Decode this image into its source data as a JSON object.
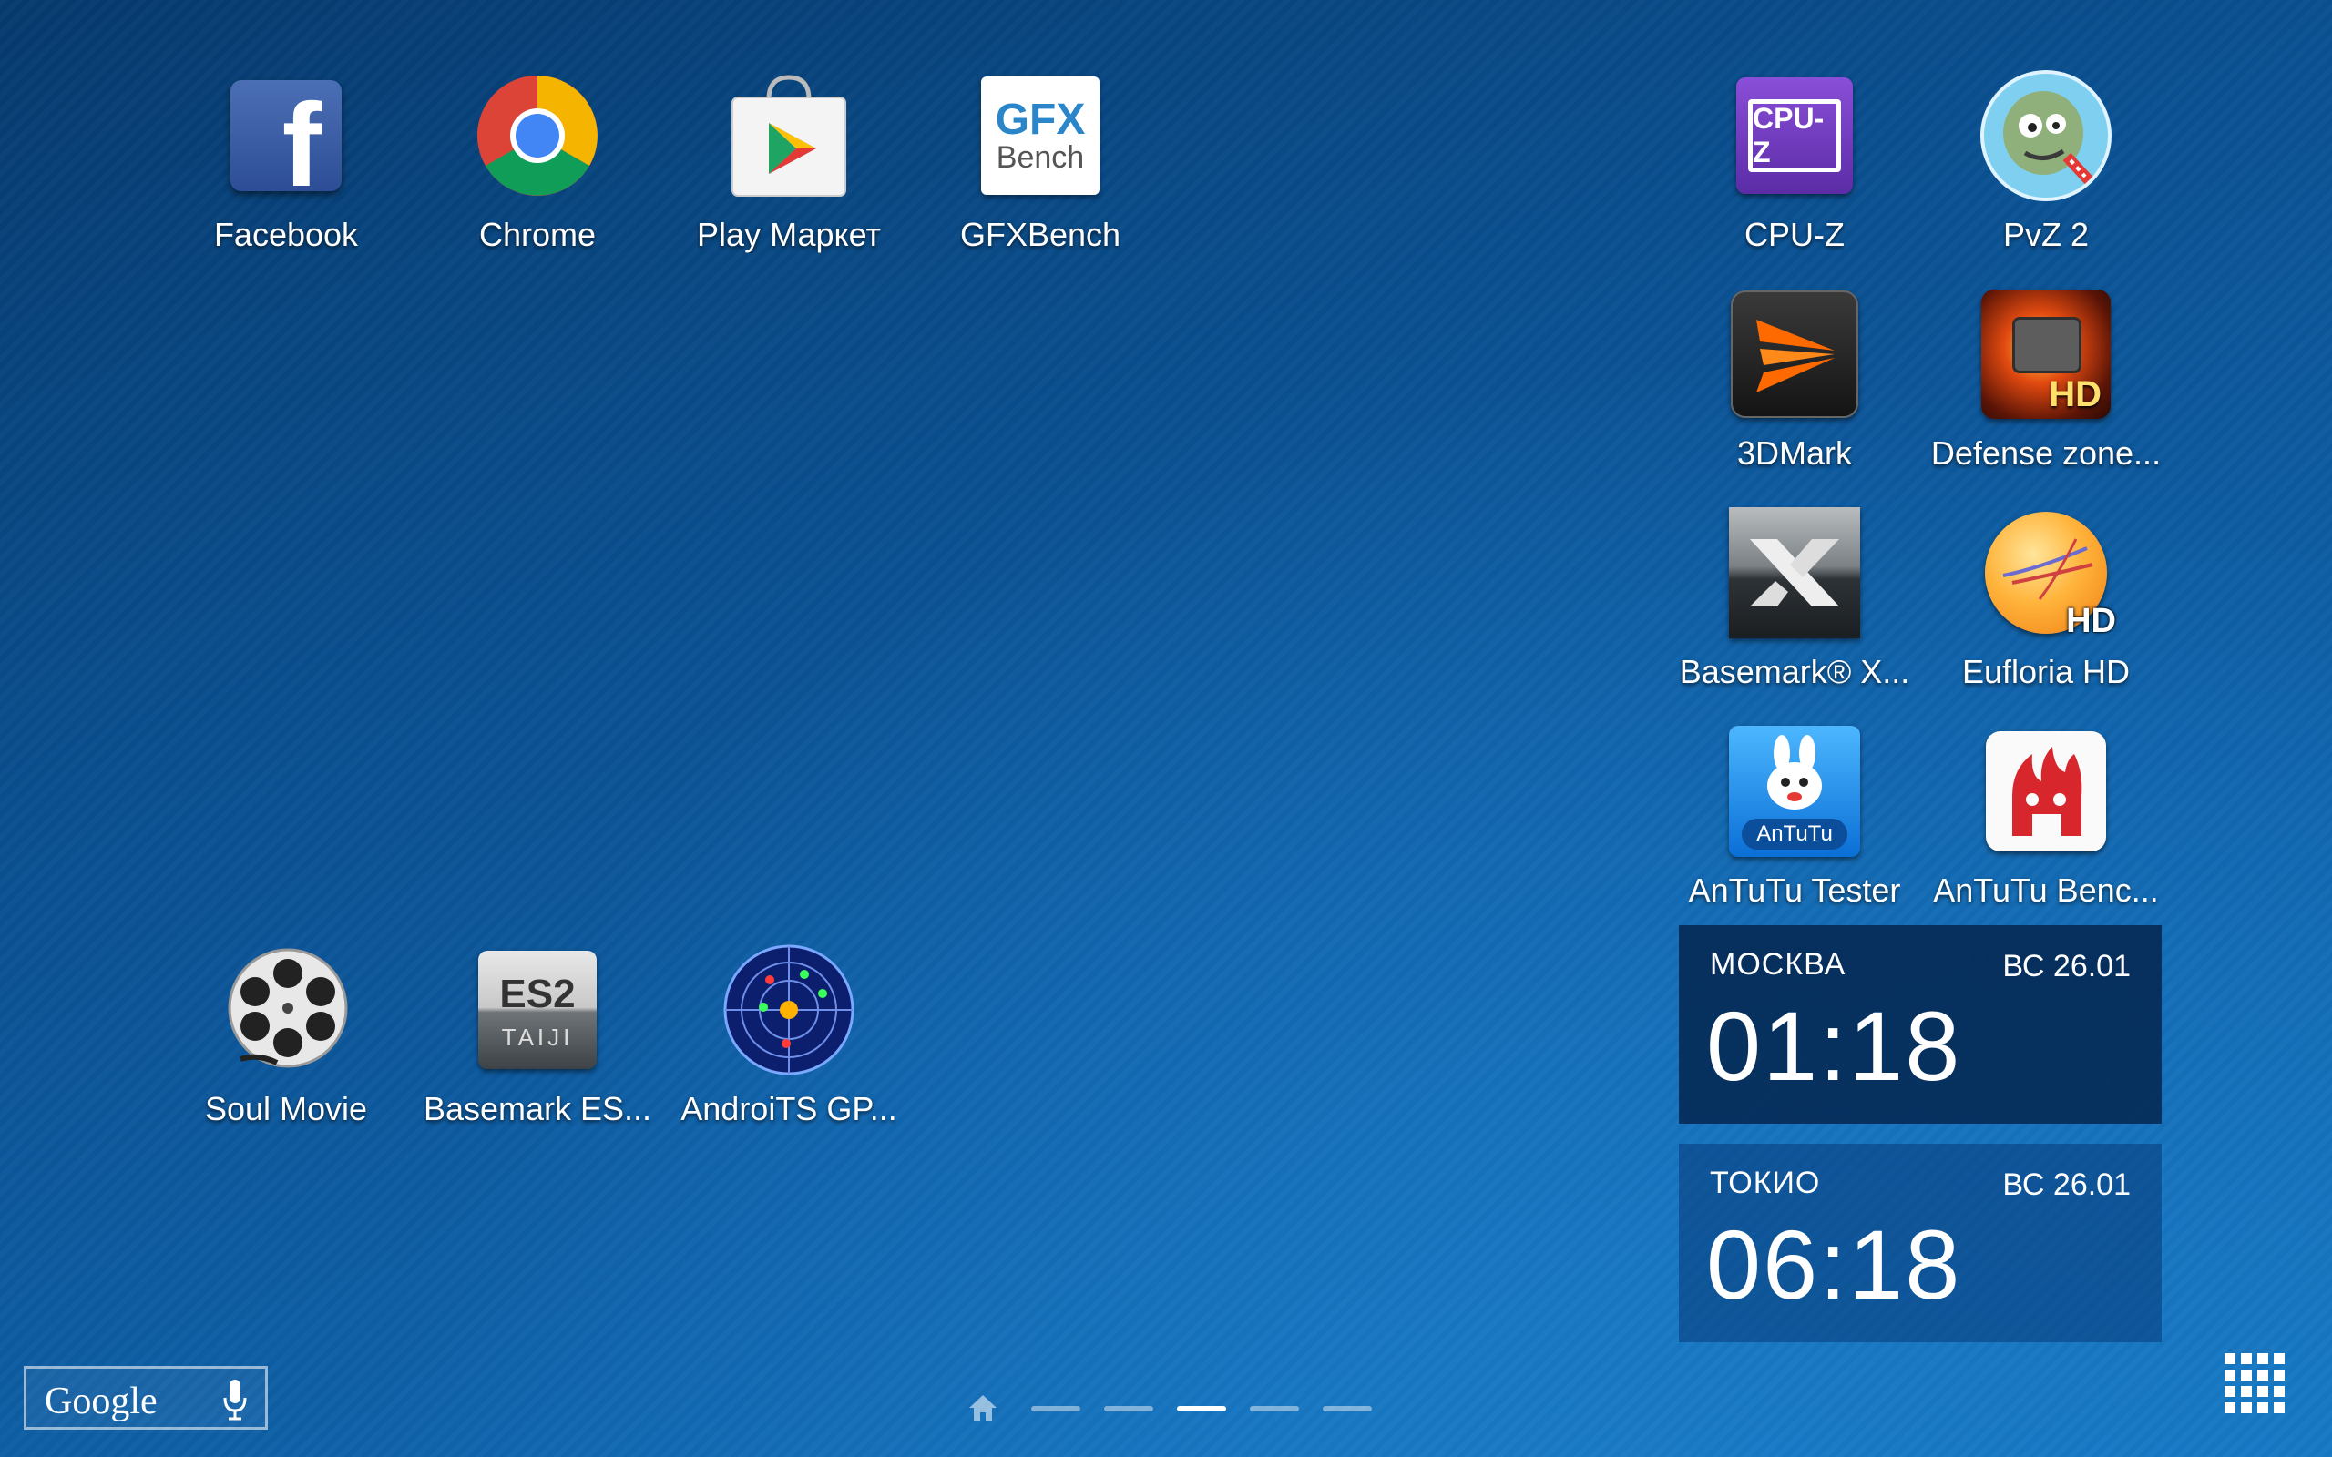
{
  "desktop": {
    "apps_top_left": [
      {
        "label": "Facebook",
        "icon": "facebook-icon"
      },
      {
        "label": "Chrome",
        "icon": "chrome-icon"
      },
      {
        "label": "Play Маркет",
        "icon": "play-store-icon"
      },
      {
        "label": "GFXBench",
        "icon": "gfxbench-icon"
      }
    ],
    "apps_bottom_left": [
      {
        "label": "Soul Movie",
        "icon": "film-reel-icon"
      },
      {
        "label": "Basemark ES...",
        "icon": "basemark-es2-icon"
      },
      {
        "label": "AndroiTS GP...",
        "icon": "gps-radar-icon"
      }
    ],
    "apps_right": [
      {
        "label": "CPU-Z",
        "icon": "cpu-z-icon"
      },
      {
        "label": "PvZ 2",
        "icon": "pvz-icon"
      },
      {
        "label": "3DMark",
        "icon": "3dmark-icon"
      },
      {
        "label": "Defense zone...",
        "icon": "defense-zone-icon"
      },
      {
        "label": "Basemark® X...",
        "icon": "basemark-x-icon"
      },
      {
        "label": "Eufloria HD",
        "icon": "eufloria-icon"
      },
      {
        "label": "AnTuTu Tester",
        "icon": "antutu-tester-icon"
      },
      {
        "label": "AnTuTu Benc...",
        "icon": "antutu-bench-icon"
      }
    ],
    "icon_text": {
      "facebook": "f",
      "gfx_top": "GFX",
      "gfx_bottom": "Bench",
      "cpuz": "CPU-Z",
      "es2": "ES2",
      "taiji": "TAIJI",
      "antutu": "AnTuTu",
      "hd": "HD"
    }
  },
  "clocks": [
    {
      "city": "МОСКВА",
      "date": "ВС 26.01",
      "time": "01:18"
    },
    {
      "city": "ТОКИО",
      "date": "ВС 26.01",
      "time": "06:18"
    }
  ],
  "search": {
    "label": "Google",
    "mic_icon": "microphone-icon"
  },
  "pager": {
    "pages": 5,
    "active_index": 2,
    "home_icon": "home-icon"
  },
  "app_drawer": {
    "icon": "app-grid-icon"
  }
}
